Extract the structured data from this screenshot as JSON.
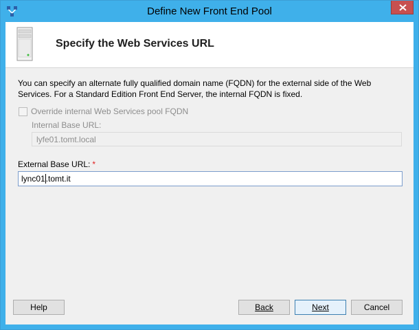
{
  "window": {
    "title": "Define New Front End Pool"
  },
  "header": {
    "title": "Specify the Web Services URL"
  },
  "description": "You can specify an alternate fully qualified domain name (FQDN) for the external side of the Web Services. For a Standard Edition Front End Server, the internal FQDN is fixed.",
  "override_checkbox": {
    "label": "Override internal Web Services pool FQDN",
    "checked": false,
    "enabled": false
  },
  "internal_url": {
    "label": "Internal Base URL:",
    "value": "lyfe01.tomt.local"
  },
  "external_url": {
    "label": "External Base URL:",
    "required_marker": "*",
    "value_before_caret": "lync01",
    "value_after_caret": ".tomt.it"
  },
  "buttons": {
    "help": "Help",
    "back": "Back",
    "next": "Next",
    "cancel": "Cancel"
  },
  "colors": {
    "titlebar": "#3fb0ea",
    "close_button": "#c75050",
    "dialog_background": "#f0f0f0",
    "required_marker": "#e02020"
  },
  "icons": {
    "app": "topology-builder-icon",
    "close": "close-icon",
    "header": "server-icon"
  }
}
